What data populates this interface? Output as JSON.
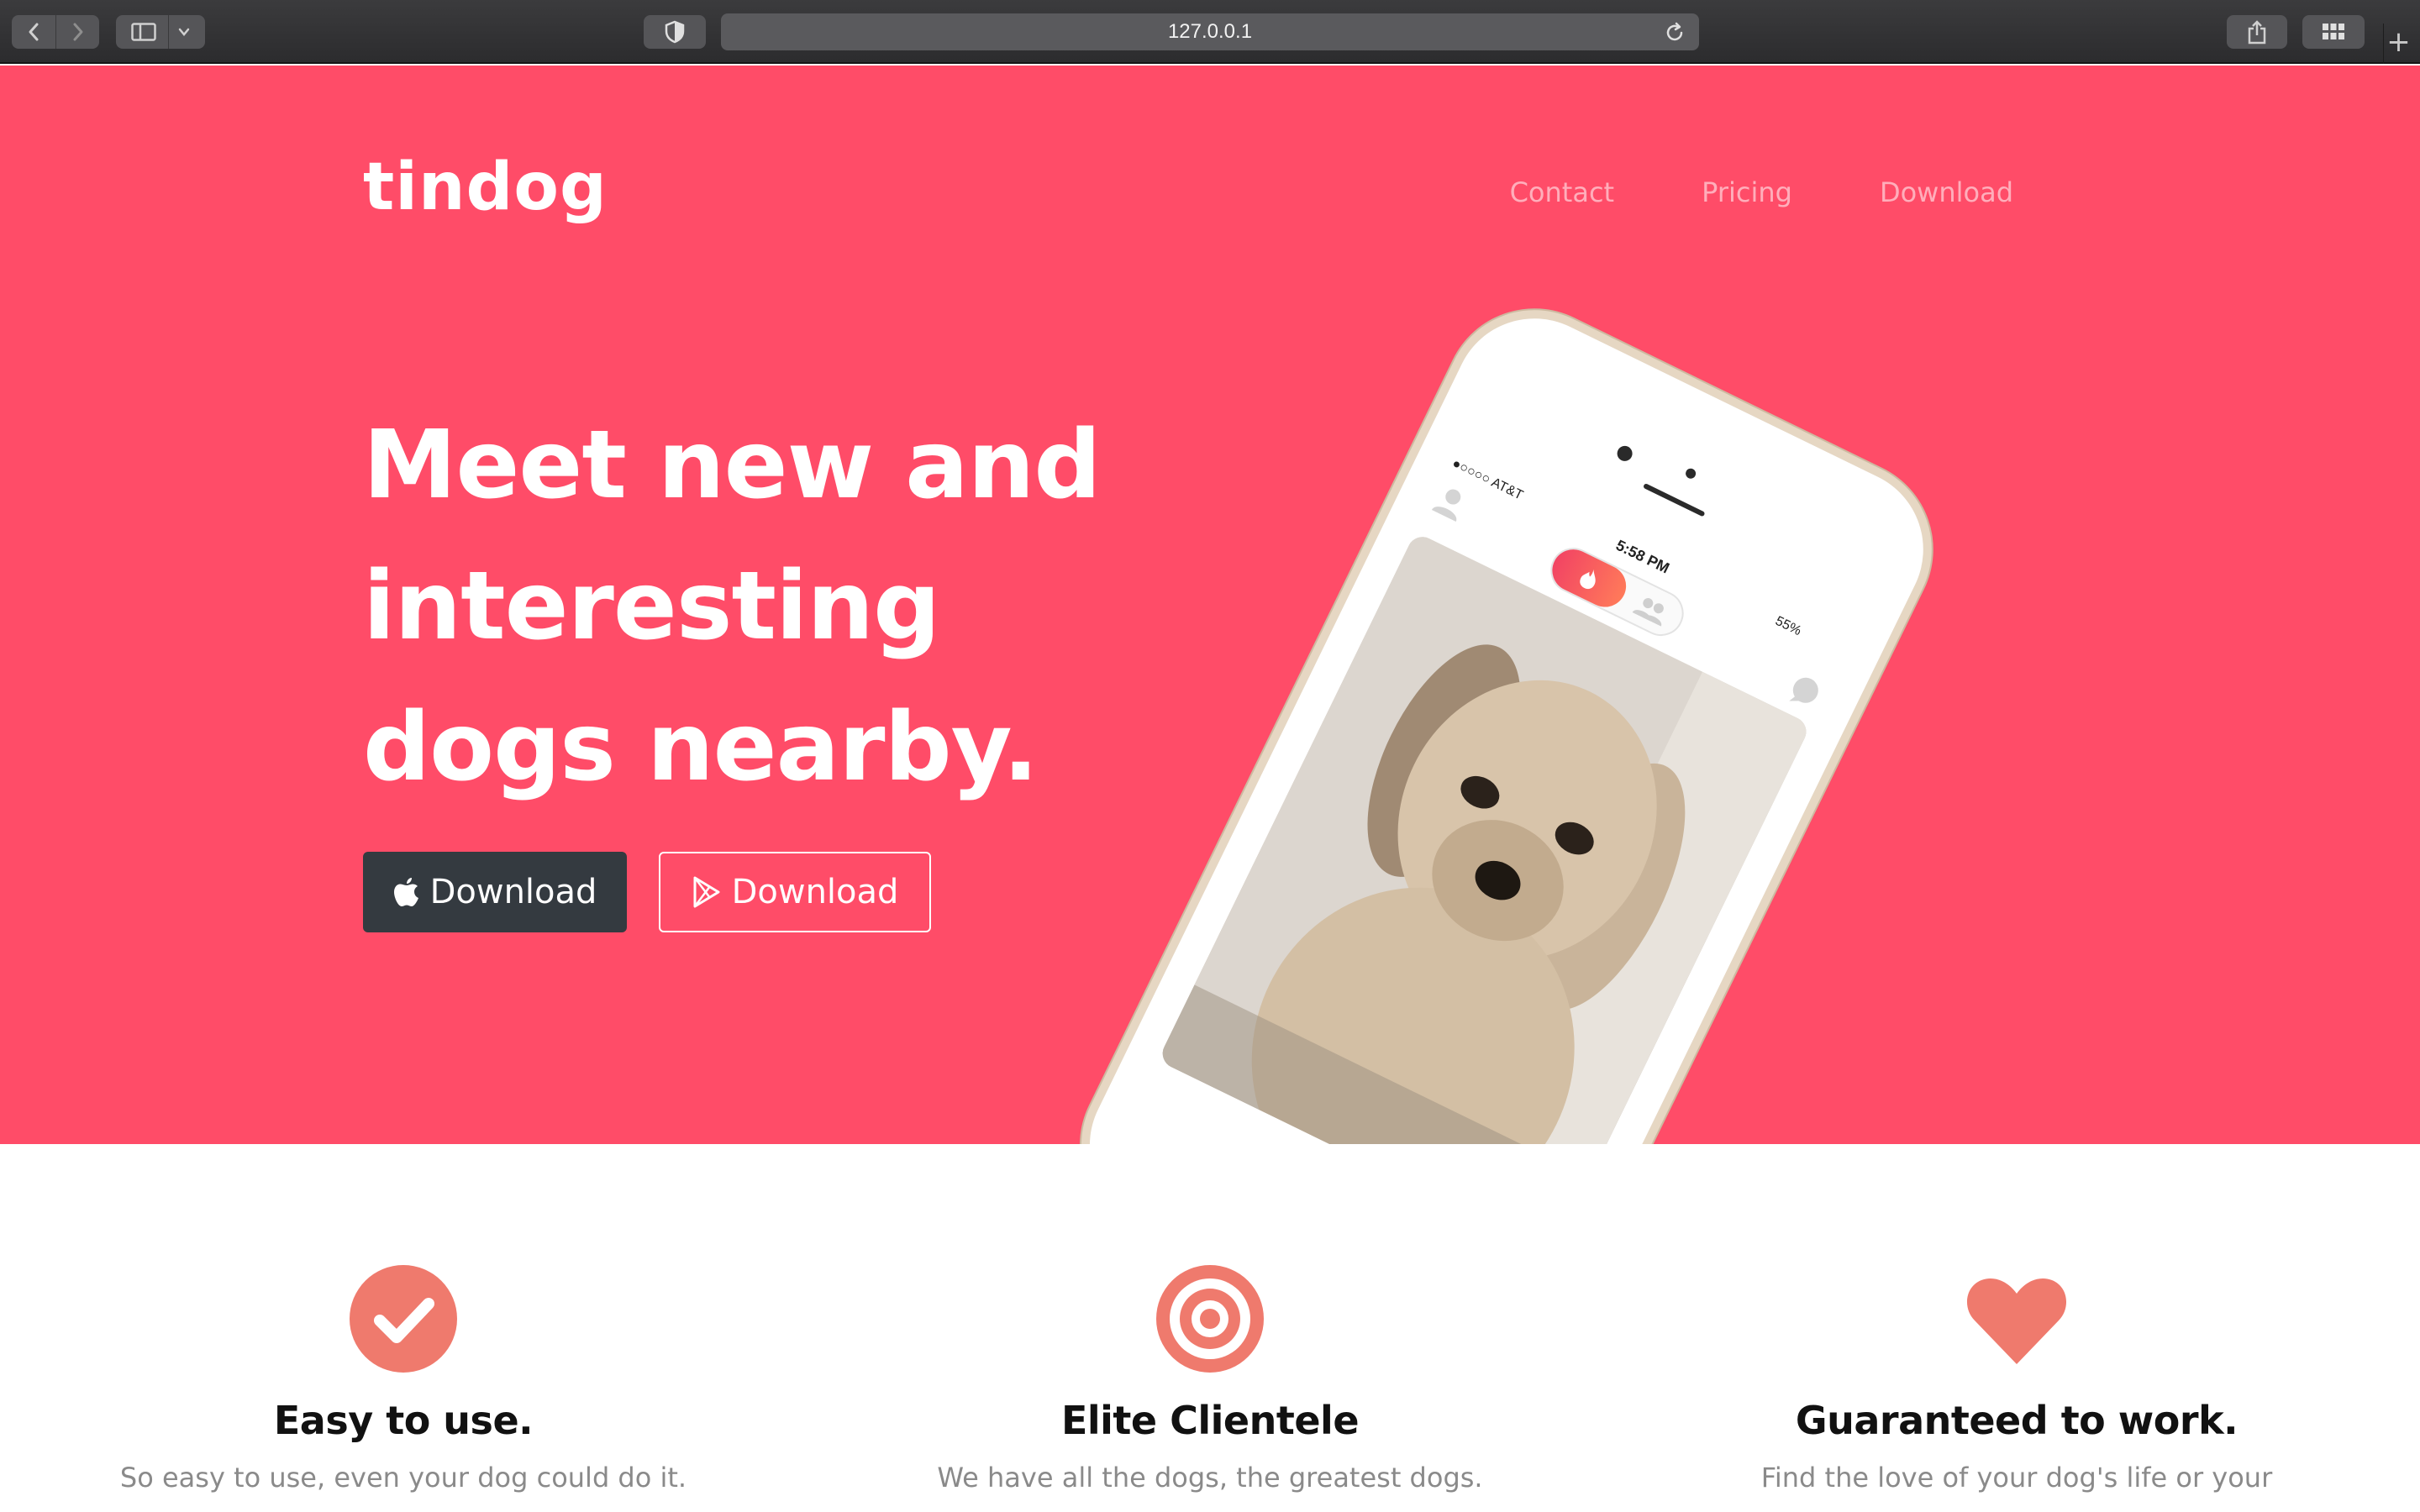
{
  "browser": {
    "url": "127.0.0.1",
    "icons": [
      "back-icon",
      "forward-icon",
      "sidebar-icon",
      "chevron-down-icon",
      "shield-icon",
      "reload-icon",
      "share-icon",
      "tabs-grid-icon",
      "new-tab-icon"
    ]
  },
  "colors": {
    "hero_bg": "#ff4c68",
    "dark_button": "#343a40",
    "accent": "#ef7a6d",
    "title": "#111111",
    "muted": "#8a8a8a"
  },
  "nav": {
    "brand": "tindog",
    "links": [
      "Contact",
      "Pricing",
      "Download"
    ]
  },
  "hero": {
    "headline": "Meet new and interesting dogs nearby.",
    "buttons": [
      {
        "label": "Download",
        "icon": "apple-icon"
      },
      {
        "label": "Download",
        "icon": "google-play-icon"
      }
    ],
    "phone": {
      "carrier": "●○○○○ AT&T",
      "time": "5:58 PM",
      "battery": "55%"
    }
  },
  "features": [
    {
      "icon": "check-circle-icon",
      "title": "Easy to use.",
      "text": "So easy to use, even your dog could do it."
    },
    {
      "icon": "bullseye-icon",
      "title": "Elite Clientele",
      "text": "We have all the dogs, the greatest dogs."
    },
    {
      "icon": "heart-icon",
      "title": "Guaranteed to work.",
      "text": "Find the love of your dog's life or your"
    }
  ]
}
